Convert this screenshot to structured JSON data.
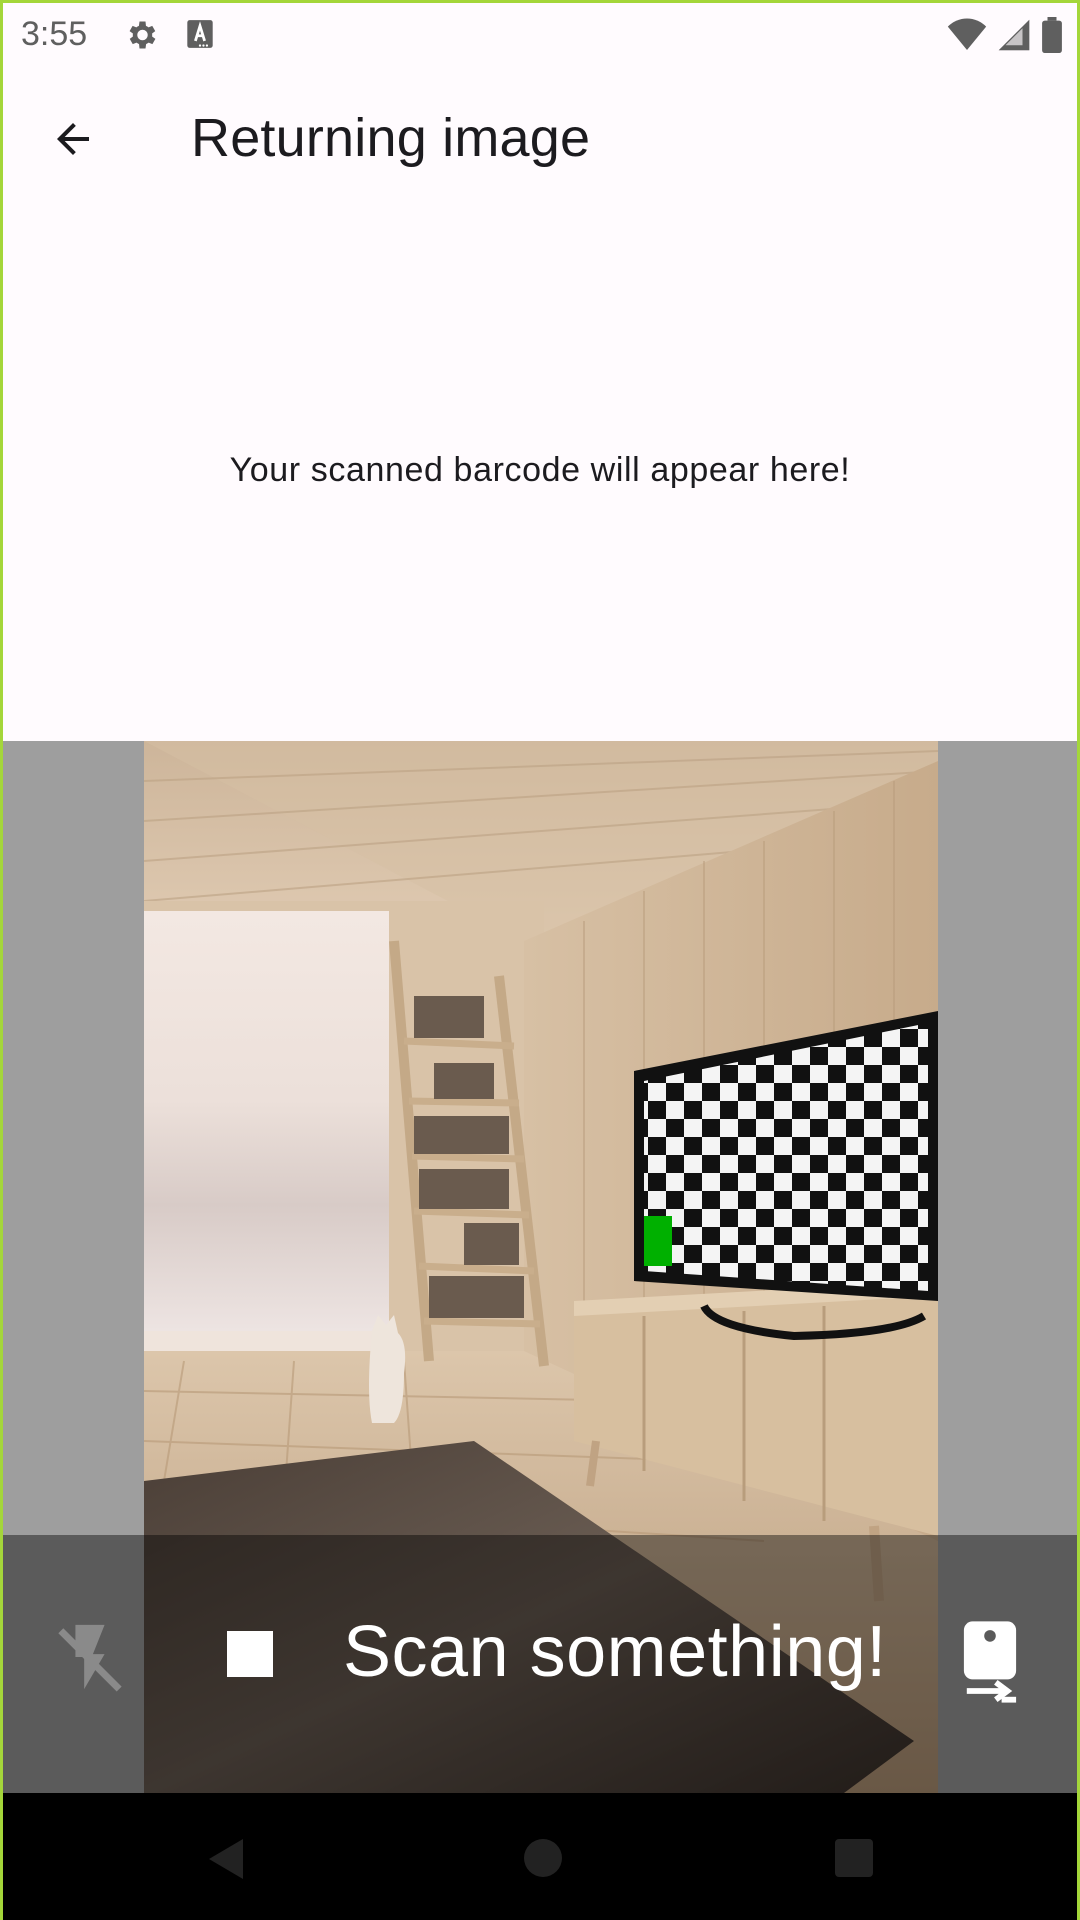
{
  "status_bar": {
    "time": "3:55",
    "icons": [
      "gear-icon",
      "keyboard-a-icon",
      "wifi-icon",
      "cell-signal-icon",
      "battery-icon"
    ]
  },
  "app_bar": {
    "title": "Returning image",
    "back_icon": "arrow-back-icon"
  },
  "result": {
    "placeholder_text": "Your scanned barcode will appear here!"
  },
  "camera": {
    "scene": "camera-preview",
    "background_color": "#9e9e9e"
  },
  "controls": {
    "flash_icon": "flash-off-icon",
    "stop_icon": "stop-icon",
    "scan_label": "Scan something!",
    "switch_camera_icon": "switch-camera-icon"
  },
  "nav_bar": {
    "icons": [
      "nav-back-icon",
      "nav-home-icon",
      "nav-recents-icon"
    ]
  },
  "colors": {
    "accent_border": "#a4d63a",
    "surface": "#fffbfe",
    "on_surface": "#1c1b1f",
    "tv_green_marker": "#00b000"
  }
}
